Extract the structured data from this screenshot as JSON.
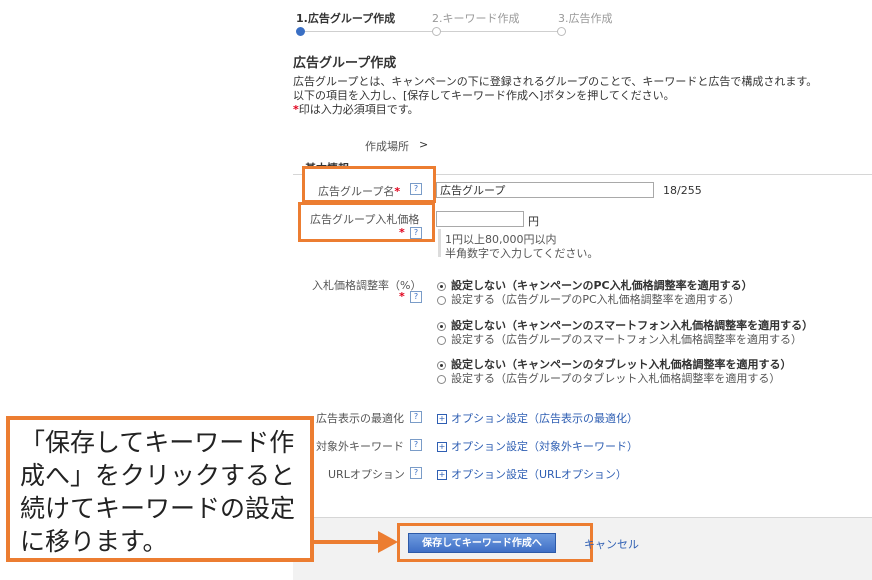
{
  "stepper": {
    "steps": [
      "1.広告グループ作成",
      "2.キーワード作成",
      "3.広告作成"
    ]
  },
  "page": {
    "title": "広告グループ作成",
    "desc1": "広告グループとは、キャンペーンの下に登録されるグループのことで、キーワードと広告で構成されます。",
    "desc2": "以下の項目を入力し、[保存してキーワード作成へ]ボタンを押してください。",
    "required_mark": "*",
    "desc3": "印は入力必須項目です。"
  },
  "location": {
    "label": "作成場所",
    "value": ">"
  },
  "section": {
    "title": "基本情報"
  },
  "form": {
    "name_label": "広告グループ名",
    "name_value": "広告グループ",
    "name_count": "18/255",
    "bid_label": "広告グループ入札価格",
    "bid_value": "",
    "bid_unit": "円",
    "bid_hint1": "1円以上80,000円以内",
    "bid_hint2": "半角数字で入力してください。",
    "adjust_label": "入札価格調整率（%）",
    "pc_off": "設定しない（キャンペーンのPC入札価格調整率を適用する）",
    "pc_on": "設定する（広告グループのPC入札価格調整率を適用する）",
    "sp_off": "設定しない（キャンペーンのスマートフォン入札価格調整率を適用する）",
    "sp_on": "設定する（広告グループのスマートフォン入札価格調整率を適用する）",
    "tab_off": "設定しない（キャンペーンのタブレット入札価格調整率を適用する）",
    "tab_on": "設定する（広告グループのタブレット入札価格調整率を適用する）",
    "opt1_label": "広告表示の最適化",
    "opt1_link": "オプション設定（広告表示の最適化）",
    "opt2_label": "対象外キーワード",
    "opt2_link": "オプション設定（対象外キーワード）",
    "opt3_label": "URLオプション",
    "opt3_link": "オプション設定（URLオプション）"
  },
  "help_glyph": "?",
  "plus_glyph": "+",
  "footer": {
    "save_label": "保存してキーワード作成へ",
    "cancel_label": "キャンセル"
  },
  "callout": {
    "text": "「保存してキーワード作成へ」をクリックすると続けてキーワードの設定に移ります。"
  },
  "colors": {
    "accent": "#ec7d31",
    "link": "#2f5fb3",
    "required": "#e0001b",
    "button": "#3f6fc6"
  }
}
